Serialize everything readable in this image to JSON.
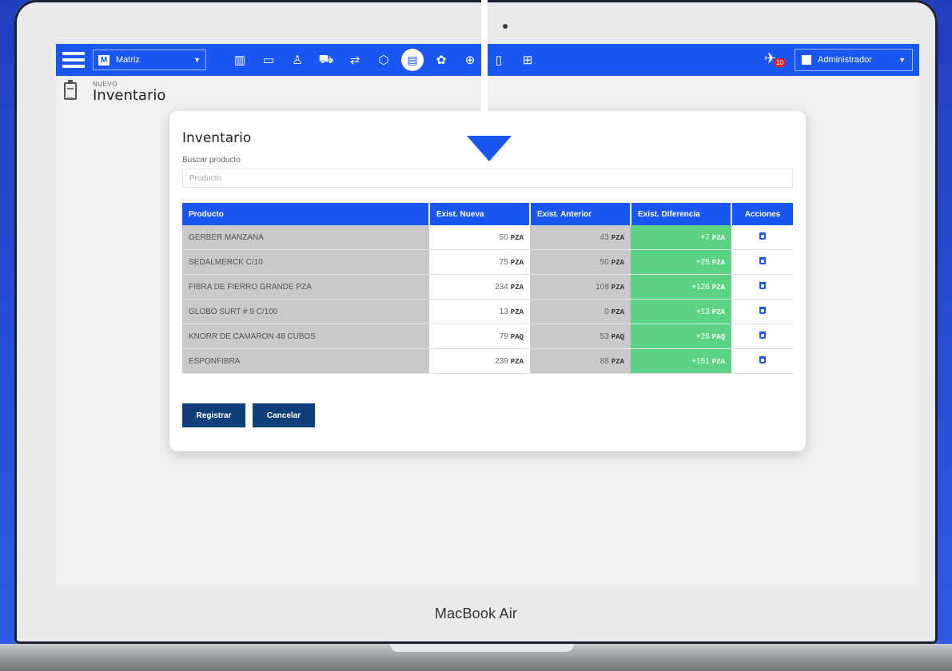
{
  "device": {
    "model_label": "MacBook Air"
  },
  "navbar": {
    "branch": {
      "badge": "M",
      "label": "Matriz"
    },
    "icons": [
      "bar-chart-icon",
      "cash-icon",
      "user-icon",
      "truck-icon",
      "transfer-icon",
      "box-icon",
      "inventory-icon",
      "gift-icon",
      "basket-icon",
      "clipboard-icon",
      "cart-icon"
    ],
    "notifications": {
      "count": "10"
    },
    "user": {
      "label": "Administrador"
    }
  },
  "page": {
    "kicker": "NUEVO",
    "title": "Inventario"
  },
  "card": {
    "title": "Inventario",
    "search": {
      "label": "Buscar producto",
      "placeholder": "Producto"
    },
    "table": {
      "headers": [
        "Producto",
        "Exist. Nueva",
        "Exist. Anterior",
        "Exist. Diferencia",
        "Acciones"
      ],
      "rows": [
        {
          "product": "GERBER MANZANA",
          "new_qty": "50",
          "new_unit": "PZA",
          "prev_qty": "43",
          "prev_unit": "PZA",
          "diff_qty": "+7",
          "diff_unit": "PZA"
        },
        {
          "product": "SEDALMERCK C/10",
          "new_qty": "75",
          "new_unit": "PZA",
          "prev_qty": "50",
          "prev_unit": "PZA",
          "diff_qty": "+25",
          "diff_unit": "PZA"
        },
        {
          "product": "FIBRA DE FIERRO GRANDE PZA",
          "new_qty": "234",
          "new_unit": "PZA",
          "prev_qty": "108",
          "prev_unit": "PZA",
          "diff_qty": "+126",
          "diff_unit": "PZA"
        },
        {
          "product": "GLOBO SURT # 9 C/100",
          "new_qty": "13",
          "new_unit": "PZA",
          "prev_qty": "0",
          "prev_unit": "PZA",
          "diff_qty": "+13",
          "diff_unit": "PZA"
        },
        {
          "product": "KNORR DE CAMARON 48 CUBOS",
          "new_qty": "79",
          "new_unit": "PAQ",
          "prev_qty": "53",
          "prev_unit": "PAQ",
          "diff_qty": "+26",
          "diff_unit": "PAQ"
        },
        {
          "product": "ESPONFIBRA",
          "new_qty": "239",
          "new_unit": "PZA",
          "prev_qty": "88",
          "prev_unit": "PZA",
          "diff_qty": "+151",
          "diff_unit": "PZA"
        }
      ]
    },
    "buttons": {
      "register": "Registrar",
      "cancel": "Cancelar"
    }
  },
  "colors": {
    "primary": "#1a56f0",
    "diff_green": "#5bd383",
    "button_navy": "#0f3f78"
  }
}
